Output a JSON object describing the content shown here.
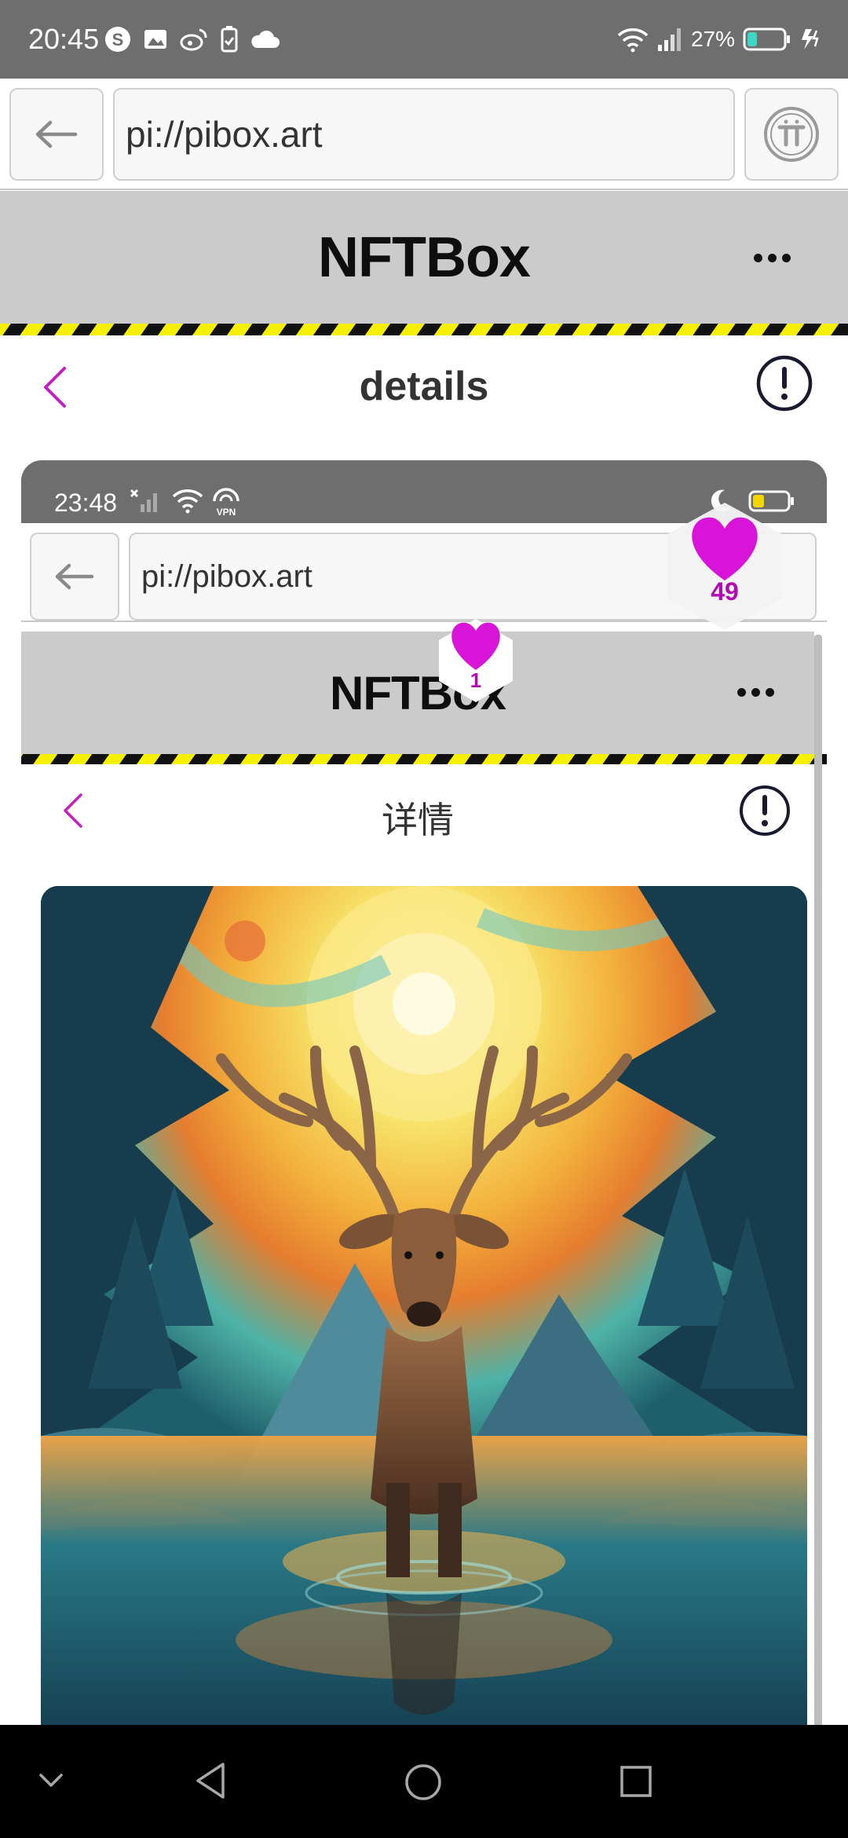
{
  "status_bar": {
    "time": "20:45",
    "battery_percent": "27%",
    "battery_level": 0.27,
    "icons_left": [
      "s-badge-icon",
      "image-icon",
      "weibo-icon",
      "battery-saver-icon",
      "cloud-icon"
    ],
    "icons_right": [
      "wifi-icon",
      "signal-icon",
      "battery-icon",
      "charging-icon"
    ]
  },
  "browser": {
    "url": "pi://pibox.art",
    "back_icon": "arrow-left-icon",
    "pi_icon": "pi-logo-icon"
  },
  "app_header": {
    "title": "NFTBox",
    "menu_icon": "more-horizontal-icon"
  },
  "page_header": {
    "title": "details",
    "back_icon": "chevron-left-icon",
    "info_icon": "exclamation-circle-icon"
  },
  "like_badge": {
    "count": "49"
  },
  "screenshot": {
    "status_bar": {
      "time": "23:48",
      "icons": [
        "no-signal-icon",
        "wifi-icon",
        "vpn-icon",
        "moon-icon",
        "battery-icon"
      ],
      "vpn_label": "VPN"
    },
    "browser": {
      "url": "pi://pibox.art"
    },
    "app_header": {
      "title": "NFTBox"
    },
    "page_header": {
      "title": "详情"
    },
    "artwork": {
      "subject": "deer-painting-image"
    },
    "like_badge": {
      "count": "1"
    }
  },
  "colors": {
    "accent": "#c21fc4",
    "heart": "#d814d8",
    "status_bar": "#6e6e6e",
    "app_header": "#cbcbcb",
    "hazard_yellow": "#f4f000"
  },
  "nav_bar": {
    "icons": [
      "chevron-down-icon",
      "back-triangle-icon",
      "home-circle-icon",
      "recents-square-icon"
    ]
  }
}
